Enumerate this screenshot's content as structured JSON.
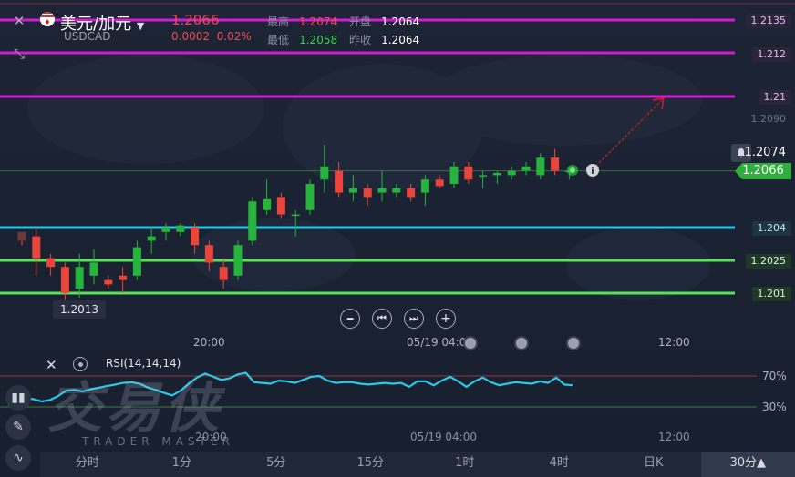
{
  "header": {
    "title": "美元/加元",
    "symbol": "USDCAD",
    "price": "1.2066",
    "change": "0.0002",
    "change_pct": "0.02%",
    "high_label": "最高",
    "high": "1.2074",
    "open_label": "开盘",
    "open": "1.2064",
    "low_label": "最低",
    "low": "1.2058",
    "prev_close_label": "昨收",
    "prev_close": "1.2064"
  },
  "price_axis": {
    "levels": [
      "1.2135",
      "1.212",
      "1.21",
      "1.2090",
      "1.2074",
      "1.2066",
      "1.204",
      "1.2025",
      "1.201"
    ]
  },
  "low_marker": "1.2013",
  "time_axis": {
    "t1": "20:00",
    "t2": "05/19 04:00",
    "t3": "12:00"
  },
  "rsi": {
    "label": "RSI(14,14,14)",
    "level_high": "70%",
    "level_low": "30%",
    "values": [
      47,
      45,
      41,
      40,
      37,
      39,
      44,
      51,
      52,
      50,
      53,
      55,
      57,
      59,
      61,
      62,
      60,
      55,
      52,
      48,
      45,
      51,
      60,
      68,
      73,
      69,
      65,
      67,
      72,
      74,
      62,
      61,
      60,
      64,
      63,
      61,
      65,
      69,
      70,
      64,
      61,
      62,
      62,
      60,
      59,
      60,
      61,
      60,
      61,
      56,
      63,
      63,
      58,
      64,
      69,
      63,
      56,
      63,
      68,
      62,
      58,
      60,
      62,
      61,
      60,
      63,
      61,
      68,
      59,
      58
    ]
  },
  "watermark": {
    "brand": "交易侠",
    "sub": "TRADER MASTER"
  },
  "timeframes": [
    "分时",
    "1分",
    "5分",
    "15分",
    "1时",
    "4时",
    "日K",
    "30分▲"
  ],
  "colors": {
    "up": "#26b43c",
    "down": "#e8453c",
    "magenta": "#d21cd2",
    "cyan": "#28c8e6",
    "green_line": "#5ce05c"
  },
  "chart_data": {
    "type": "candlestick",
    "candles": [
      {
        "o": 1.2038,
        "h": 1.2038,
        "l": 1.2032,
        "c": 1.2034
      },
      {
        "o": 1.2036,
        "h": 1.204,
        "l": 1.2018,
        "c": 1.2026
      },
      {
        "o": 1.2026,
        "h": 1.2028,
        "l": 1.2018,
        "c": 1.2022
      },
      {
        "o": 1.2022,
        "h": 1.2024,
        "l": 1.2006,
        "c": 1.201
      },
      {
        "o": 1.2012,
        "h": 1.2028,
        "l": 1.2008,
        "c": 1.2022
      },
      {
        "o": 1.2018,
        "h": 1.203,
        "l": 1.2014,
        "c": 1.2024
      },
      {
        "o": 1.2016,
        "h": 1.2018,
        "l": 1.2012,
        "c": 1.2014
      },
      {
        "o": 1.2018,
        "h": 1.2022,
        "l": 1.201,
        "c": 1.2016
      },
      {
        "o": 1.2018,
        "h": 1.2034,
        "l": 1.2016,
        "c": 1.2031
      },
      {
        "o": 1.2034,
        "h": 1.204,
        "l": 1.2028,
        "c": 1.2036
      },
      {
        "o": 1.2038,
        "h": 1.2042,
        "l": 1.2034,
        "c": 1.204
      },
      {
        "o": 1.2038,
        "h": 1.2042,
        "l": 1.2036,
        "c": 1.2041
      },
      {
        "o": 1.204,
        "h": 1.2042,
        "l": 1.2028,
        "c": 1.2032
      },
      {
        "o": 1.2032,
        "h": 1.2034,
        "l": 1.202,
        "c": 1.2024
      },
      {
        "o": 1.2022,
        "h": 1.2026,
        "l": 1.2012,
        "c": 1.2016
      },
      {
        "o": 1.2018,
        "h": 1.2034,
        "l": 1.2016,
        "c": 1.2032
      },
      {
        "o": 1.2034,
        "h": 1.2054,
        "l": 1.2032,
        "c": 1.2052
      },
      {
        "o": 1.2048,
        "h": 1.2062,
        "l": 1.2046,
        "c": 1.2053
      },
      {
        "o": 1.2054,
        "h": 1.2056,
        "l": 1.2044,
        "c": 1.2046
      },
      {
        "o": 1.2046,
        "h": 1.2048,
        "l": 1.2036,
        "c": 1.2046
      },
      {
        "o": 1.2048,
        "h": 1.2062,
        "l": 1.2046,
        "c": 1.206
      },
      {
        "o": 1.2062,
        "h": 1.2078,
        "l": 1.2056,
        "c": 1.2068
      },
      {
        "o": 1.2066,
        "h": 1.207,
        "l": 1.2054,
        "c": 1.2056
      },
      {
        "o": 1.2056,
        "h": 1.2064,
        "l": 1.2052,
        "c": 1.2058
      },
      {
        "o": 1.2058,
        "h": 1.206,
        "l": 1.205,
        "c": 1.2054
      },
      {
        "o": 1.2056,
        "h": 1.2066,
        "l": 1.2052,
        "c": 1.2058
      },
      {
        "o": 1.2056,
        "h": 1.206,
        "l": 1.2054,
        "c": 1.2058
      },
      {
        "o": 1.2058,
        "h": 1.206,
        "l": 1.2052,
        "c": 1.2054
      },
      {
        "o": 1.2056,
        "h": 1.2064,
        "l": 1.205,
        "c": 1.2062
      },
      {
        "o": 1.2062,
        "h": 1.2064,
        "l": 1.2058,
        "c": 1.2059
      },
      {
        "o": 1.206,
        "h": 1.207,
        "l": 1.2058,
        "c": 1.2068
      },
      {
        "o": 1.2068,
        "h": 1.207,
        "l": 1.206,
        "c": 1.2062
      },
      {
        "o": 1.2064,
        "h": 1.2066,
        "l": 1.2058,
        "c": 1.2064
      },
      {
        "o": 1.2064,
        "h": 1.2066,
        "l": 1.206,
        "c": 1.2065
      },
      {
        "o": 1.2064,
        "h": 1.2068,
        "l": 1.2062,
        "c": 1.2066
      },
      {
        "o": 1.2066,
        "h": 1.207,
        "l": 1.2064,
        "c": 1.2068
      },
      {
        "o": 1.2064,
        "h": 1.2074,
        "l": 1.2062,
        "c": 1.2072
      },
      {
        "o": 1.2072,
        "h": 1.2076,
        "l": 1.2064,
        "c": 1.2066
      },
      {
        "o": 1.2066,
        "h": 1.2068,
        "l": 1.2062,
        "c": 1.2066
      }
    ],
    "hlines": [
      {
        "value": 1.2135,
        "color": "#d21cd2"
      },
      {
        "value": 1.212,
        "color": "#d21cd2"
      },
      {
        "value": 1.21,
        "color": "#d21cd2"
      },
      {
        "value": 1.204,
        "color": "#28c8e6"
      },
      {
        "value": 1.2025,
        "color": "#5ce05c"
      },
      {
        "value": 1.201,
        "color": "#5ce05c"
      }
    ],
    "current_price": 1.2066,
    "ylim": [
      1.2005,
      1.214
    ]
  }
}
